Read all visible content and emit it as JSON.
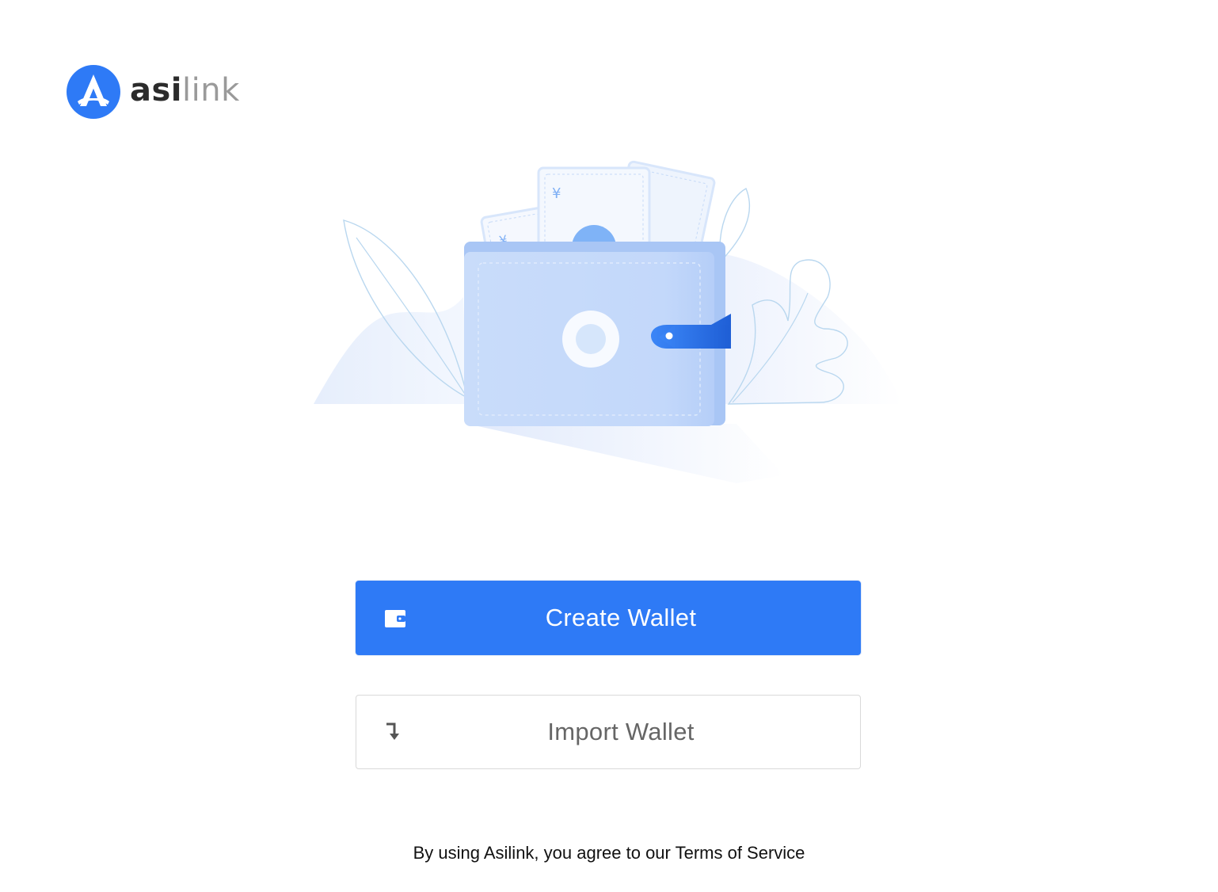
{
  "brand": {
    "name_part1": "asi",
    "name_part2": "link",
    "logo_icon": "asilink-logo-icon",
    "accent_color": "#2e7af6"
  },
  "illustration": {
    "icon": "wallet-illustration"
  },
  "actions": {
    "create": {
      "label": "Create Wallet",
      "icon": "wallet-icon"
    },
    "import": {
      "label": "Import Wallet",
      "icon": "import-arrow-icon"
    }
  },
  "footer": {
    "terms_text": "By using Asilink, you agree to our Terms of Service"
  }
}
